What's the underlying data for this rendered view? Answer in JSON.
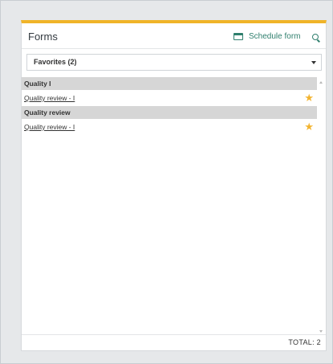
{
  "panel": {
    "title": "Forms",
    "schedule_label": "Schedule form"
  },
  "filter": {
    "selected": "Favorites (2)"
  },
  "groups": [
    {
      "name": "Quality I",
      "items": [
        {
          "label": "Quality review - I",
          "favorite": true
        }
      ]
    },
    {
      "name": "Quality review",
      "items": [
        {
          "label": "Quality review - I",
          "favorite": true
        }
      ]
    }
  ],
  "footer": {
    "total_text": "TOTAL:  2"
  },
  "icons": {
    "schedule": "calendar-icon",
    "search": "search-icon",
    "dropdown": "chevron-down-icon",
    "favorite": "star-icon"
  },
  "colors": {
    "accent": "#f0b429",
    "link": "#2f7f6d",
    "star": "#f3b430"
  },
  "glyphs": {
    "star": "★"
  }
}
